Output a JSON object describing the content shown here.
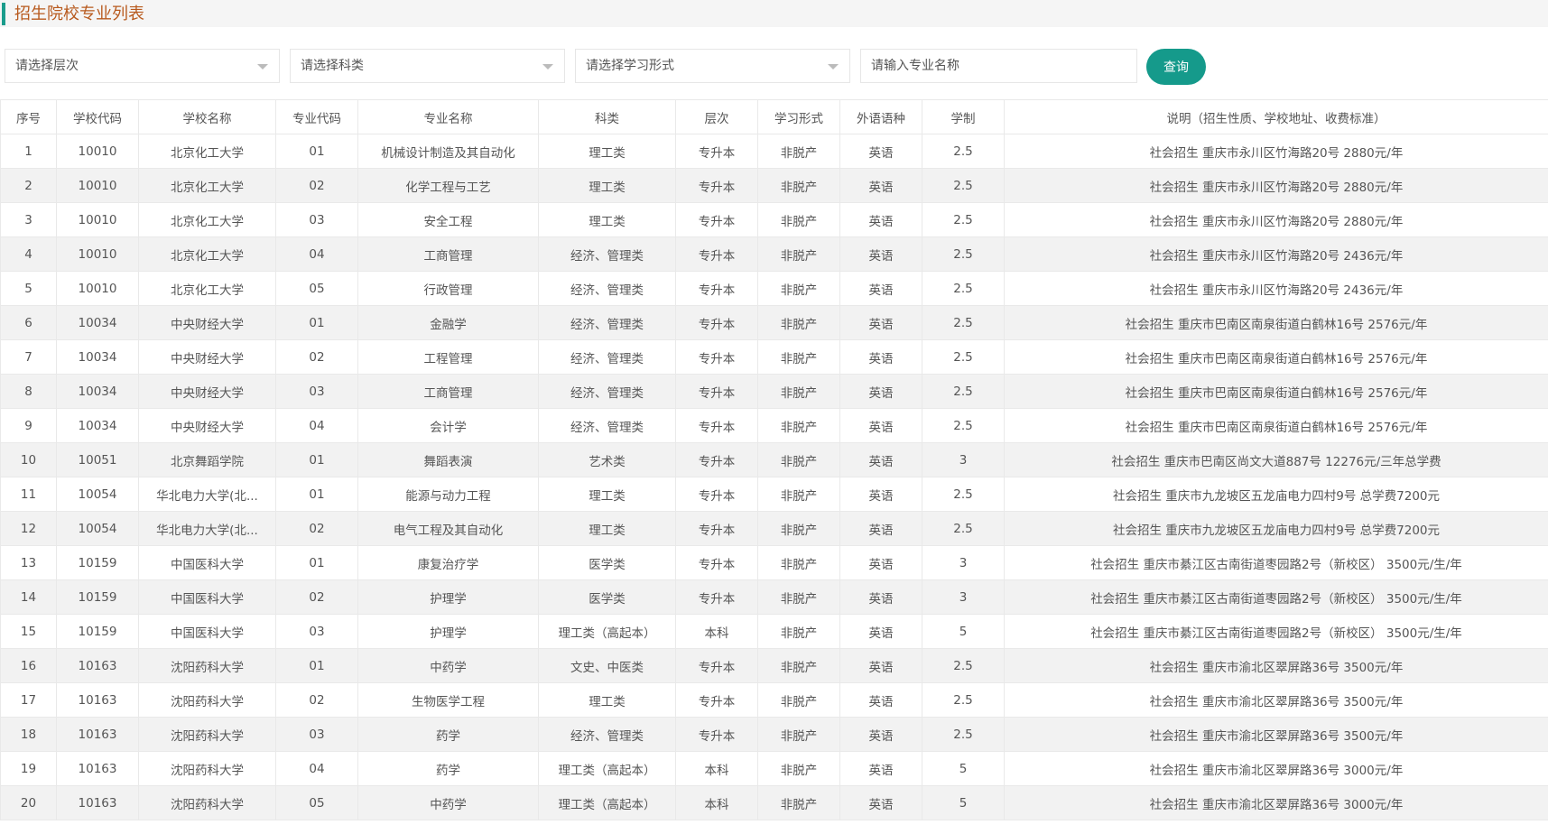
{
  "page": {
    "title": "招生院校专业列表"
  },
  "filters": {
    "level_placeholder": "请选择层次",
    "category_placeholder": "请选择科类",
    "study_form_placeholder": "请选择学习形式",
    "major_input_placeholder": "请输入专业名称",
    "query_label": "查询"
  },
  "colors": {
    "accent": "#159a8b",
    "title": "#b85a1e",
    "stripe": "#f2f2f2"
  },
  "table": {
    "columns": [
      "序号",
      "学校代码",
      "学校名称",
      "专业代码",
      "专业名称",
      "科类",
      "层次",
      "学习形式",
      "外语语种",
      "学制",
      "说明（招生性质、学校地址、收费标准）"
    ],
    "rows": [
      [
        "1",
        "10010",
        "北京化工大学",
        "01",
        "机械设计制造及其自动化",
        "理工类",
        "专升本",
        "非脱产",
        "英语",
        "2.5",
        "社会招生 重庆市永川区竹海路20号 2880元/年"
      ],
      [
        "2",
        "10010",
        "北京化工大学",
        "02",
        "化学工程与工艺",
        "理工类",
        "专升本",
        "非脱产",
        "英语",
        "2.5",
        "社会招生 重庆市永川区竹海路20号 2880元/年"
      ],
      [
        "3",
        "10010",
        "北京化工大学",
        "03",
        "安全工程",
        "理工类",
        "专升本",
        "非脱产",
        "英语",
        "2.5",
        "社会招生 重庆市永川区竹海路20号 2880元/年"
      ],
      [
        "4",
        "10010",
        "北京化工大学",
        "04",
        "工商管理",
        "经济、管理类",
        "专升本",
        "非脱产",
        "英语",
        "2.5",
        "社会招生 重庆市永川区竹海路20号 2436元/年"
      ],
      [
        "5",
        "10010",
        "北京化工大学",
        "05",
        "行政管理",
        "经济、管理类",
        "专升本",
        "非脱产",
        "英语",
        "2.5",
        "社会招生 重庆市永川区竹海路20号 2436元/年"
      ],
      [
        "6",
        "10034",
        "中央财经大学",
        "01",
        "金融学",
        "经济、管理类",
        "专升本",
        "非脱产",
        "英语",
        "2.5",
        "社会招生 重庆市巴南区南泉街道白鹤林16号 2576元/年"
      ],
      [
        "7",
        "10034",
        "中央财经大学",
        "02",
        "工程管理",
        "经济、管理类",
        "专升本",
        "非脱产",
        "英语",
        "2.5",
        "社会招生 重庆市巴南区南泉街道白鹤林16号 2576元/年"
      ],
      [
        "8",
        "10034",
        "中央财经大学",
        "03",
        "工商管理",
        "经济、管理类",
        "专升本",
        "非脱产",
        "英语",
        "2.5",
        "社会招生 重庆市巴南区南泉街道白鹤林16号 2576元/年"
      ],
      [
        "9",
        "10034",
        "中央财经大学",
        "04",
        "会计学",
        "经济、管理类",
        "专升本",
        "非脱产",
        "英语",
        "2.5",
        "社会招生 重庆市巴南区南泉街道白鹤林16号 2576元/年"
      ],
      [
        "10",
        "10051",
        "北京舞蹈学院",
        "01",
        "舞蹈表演",
        "艺术类",
        "专升本",
        "非脱产",
        "英语",
        "3",
        "社会招生 重庆市巴南区尚文大道887号 12276元/三年总学费"
      ],
      [
        "11",
        "10054",
        "华北电力大学(北...",
        "01",
        "能源与动力工程",
        "理工类",
        "专升本",
        "非脱产",
        "英语",
        "2.5",
        "社会招生 重庆市九龙坡区五龙庙电力四村9号 总学费7200元"
      ],
      [
        "12",
        "10054",
        "华北电力大学(北...",
        "02",
        "电气工程及其自动化",
        "理工类",
        "专升本",
        "非脱产",
        "英语",
        "2.5",
        "社会招生 重庆市九龙坡区五龙庙电力四村9号 总学费7200元"
      ],
      [
        "13",
        "10159",
        "中国医科大学",
        "01",
        "康复治疗学",
        "医学类",
        "专升本",
        "非脱产",
        "英语",
        "3",
        "社会招生 重庆市綦江区古南街道枣园路2号（新校区） 3500元/生/年"
      ],
      [
        "14",
        "10159",
        "中国医科大学",
        "02",
        "护理学",
        "医学类",
        "专升本",
        "非脱产",
        "英语",
        "3",
        "社会招生 重庆市綦江区古南街道枣园路2号（新校区） 3500元/生/年"
      ],
      [
        "15",
        "10159",
        "中国医科大学",
        "03",
        "护理学",
        "理工类（高起本）",
        "本科",
        "非脱产",
        "英语",
        "5",
        "社会招生 重庆市綦江区古南街道枣园路2号（新校区） 3500元/生/年"
      ],
      [
        "16",
        "10163",
        "沈阳药科大学",
        "01",
        "中药学",
        "文史、中医类",
        "专升本",
        "非脱产",
        "英语",
        "2.5",
        "社会招生 重庆市渝北区翠屏路36号 3500元/年"
      ],
      [
        "17",
        "10163",
        "沈阳药科大学",
        "02",
        "生物医学工程",
        "理工类",
        "专升本",
        "非脱产",
        "英语",
        "2.5",
        "社会招生 重庆市渝北区翠屏路36号 3500元/年"
      ],
      [
        "18",
        "10163",
        "沈阳药科大学",
        "03",
        "药学",
        "经济、管理类",
        "专升本",
        "非脱产",
        "英语",
        "2.5",
        "社会招生 重庆市渝北区翠屏路36号 3500元/年"
      ],
      [
        "19",
        "10163",
        "沈阳药科大学",
        "04",
        "药学",
        "理工类（高起本）",
        "本科",
        "非脱产",
        "英语",
        "5",
        "社会招生 重庆市渝北区翠屏路36号 3000元/年"
      ],
      [
        "20",
        "10163",
        "沈阳药科大学",
        "05",
        "中药学",
        "理工类（高起本）",
        "本科",
        "非脱产",
        "英语",
        "5",
        "社会招生 重庆市渝北区翠屏路36号 3000元/年"
      ]
    ]
  }
}
